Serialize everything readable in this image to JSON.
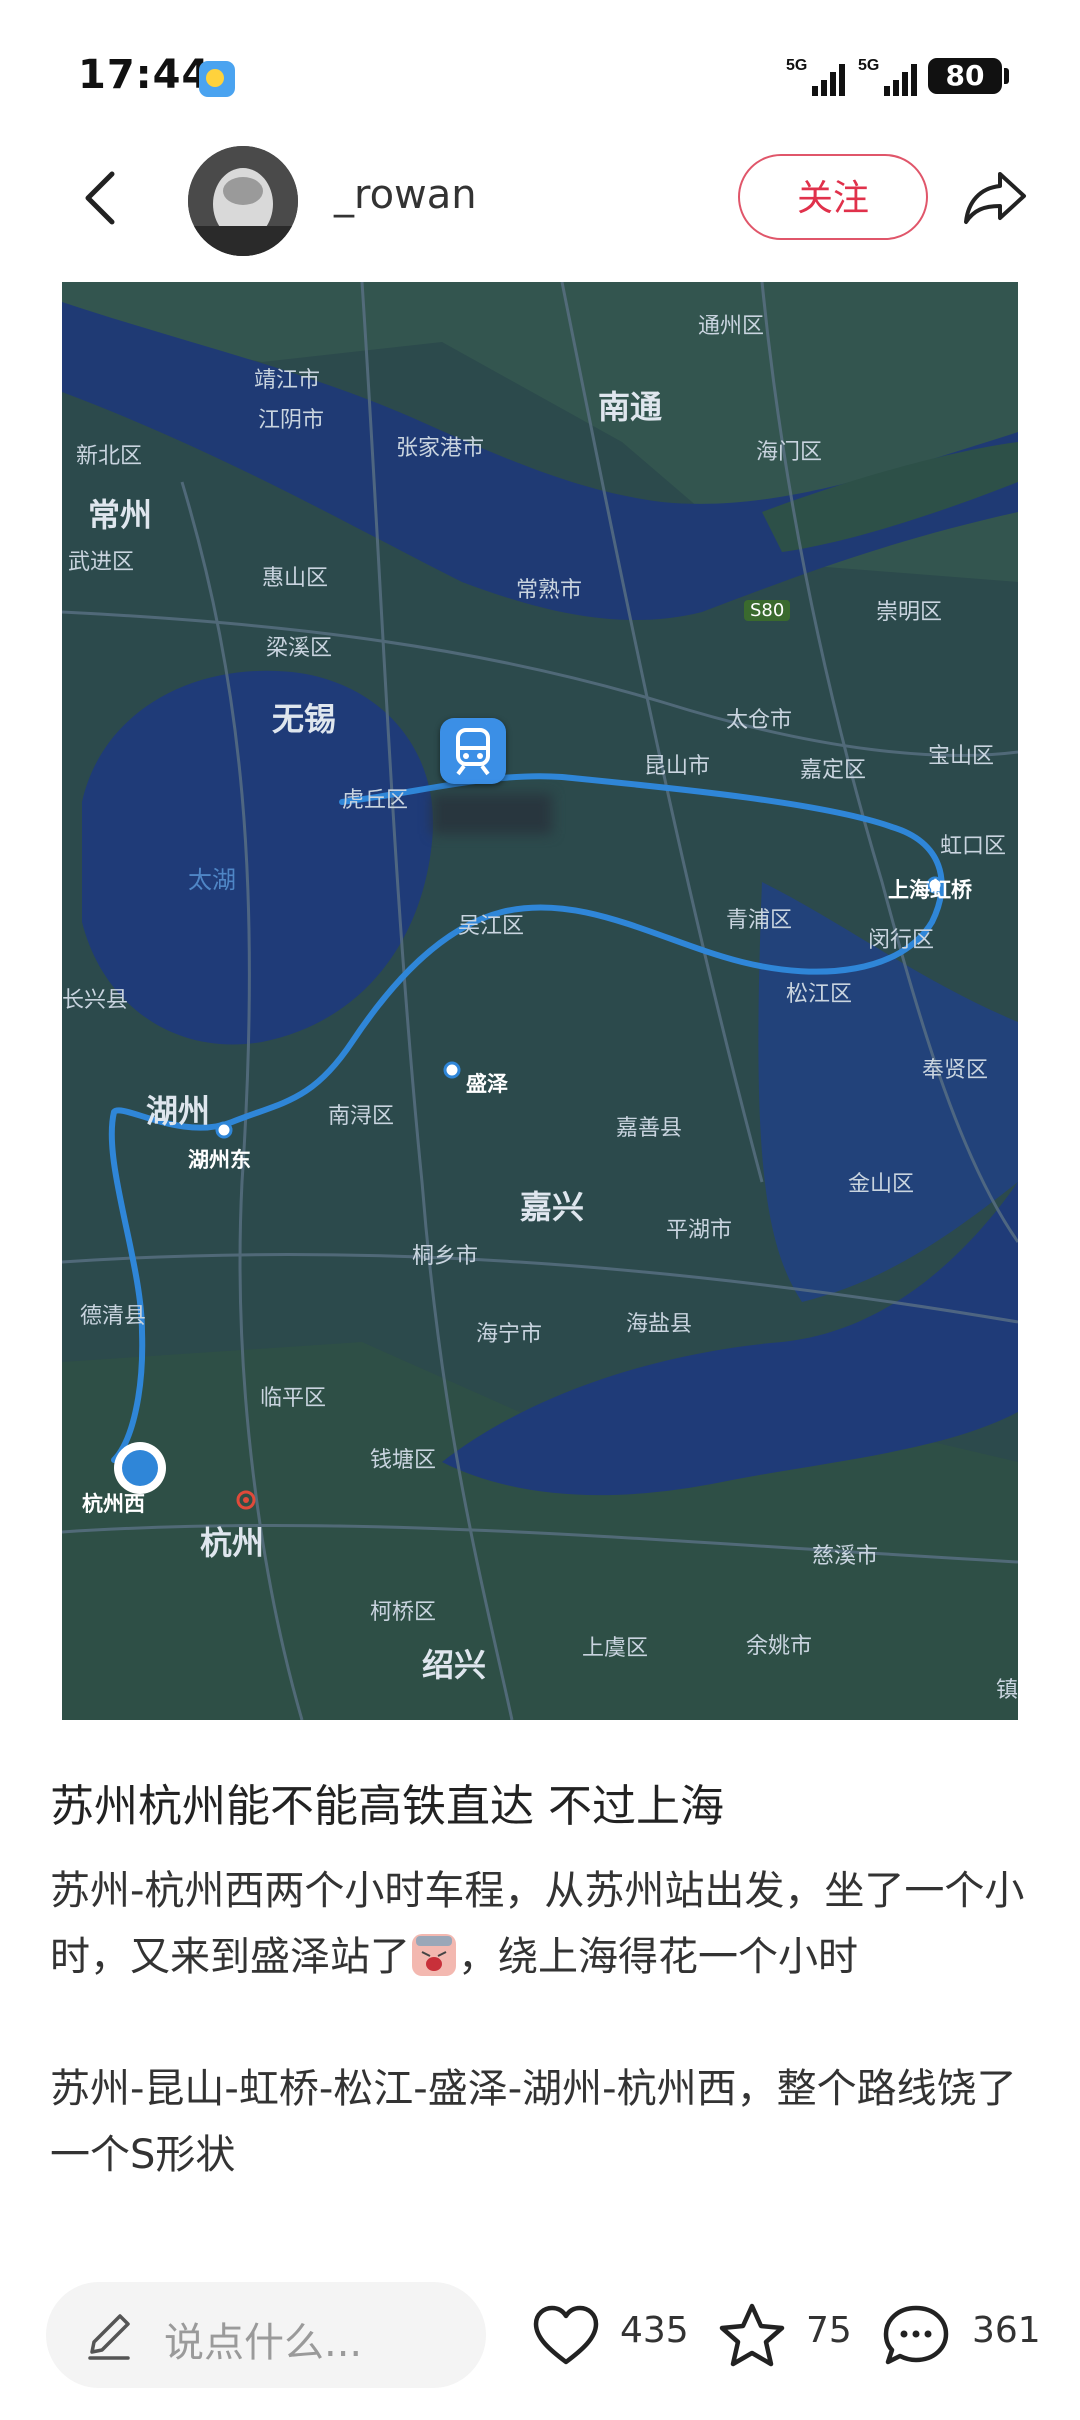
{
  "status_bar": {
    "time": "17:44",
    "network_1": "5G",
    "network_2": "5G",
    "battery": "80"
  },
  "header": {
    "username": "_rowan",
    "follow_label": "关注"
  },
  "map": {
    "labels": {
      "tongzhou": "通州区",
      "jingjiang": "靖江市",
      "nantong": "南通",
      "jiangyin": "江阴市",
      "zhangjiagang": "张家港市",
      "haimen": "海门区",
      "xinbei": "新北区",
      "changzhou": "常州",
      "wujin": "武进区",
      "huishan": "惠山区",
      "changshu": "常熟市",
      "s80": "S80",
      "chongming": "崇明区",
      "liangxi": "梁溪区",
      "wuxi": "无锡",
      "taicang": "太仓市",
      "kunshan": "昆山市",
      "jiading": "嘉定区",
      "baoshan": "宝山区",
      "huqiu": "虎丘区",
      "hongkou": "虹口区",
      "taihu": "太湖",
      "shanghai_hongqiao": "上海虹桥",
      "wujiang": "吴江区",
      "qingpu": "青浦区",
      "minhang": "闵行区",
      "changxing": "长兴县",
      "songjiang": "松江区",
      "fengxian": "奉贤区",
      "huzhou": "湖州",
      "nanxun": "南浔区",
      "shengze": "盛泽",
      "huzhou_east": "湖州东",
      "jiashan": "嘉善县",
      "jiaxing": "嘉兴",
      "jinshan": "金山区",
      "pinghu": "平湖市",
      "tongxiang": "桐乡市",
      "deqing": "德清县",
      "haining": "海宁市",
      "haiyan": "海盐县",
      "linping": "临平区",
      "qiantang": "钱塘区",
      "hangzhou_west": "杭州西",
      "hangzhou": "杭州",
      "cixi": "慈溪市",
      "keqiao": "柯桥区",
      "shangyu": "上虞区",
      "yuyao": "余姚市",
      "shaoxing": "绍兴",
      "zhen": "镇"
    }
  },
  "post": {
    "title": "苏州杭州能不能高铁直达 不过上海",
    "paragraph_1_a": "苏州-杭州西两个小时车程，从苏州站出发，坐了一个小时，又来到盛泽站了",
    "paragraph_1_b": "，绕上海得花一个小时",
    "paragraph_2": "苏州-昆山-虹桥-松江-盛泽-湖州-杭州西，整个路线饶了一个S形状"
  },
  "bottom_bar": {
    "comment_placeholder": "说点什么...",
    "likes": "435",
    "favorites": "75",
    "comments": "361"
  },
  "colors": {
    "accent": "#e0314b",
    "route": "#2f86d8",
    "map_water": "#1f3b78",
    "map_land": "#2c4a4a"
  },
  "icons": [
    "back-arrow-icon",
    "share-icon",
    "train-icon",
    "pen-icon",
    "heart-icon",
    "star-icon",
    "comment-icon",
    "weather-sun-icon",
    "signal-icon",
    "battery-icon"
  ]
}
